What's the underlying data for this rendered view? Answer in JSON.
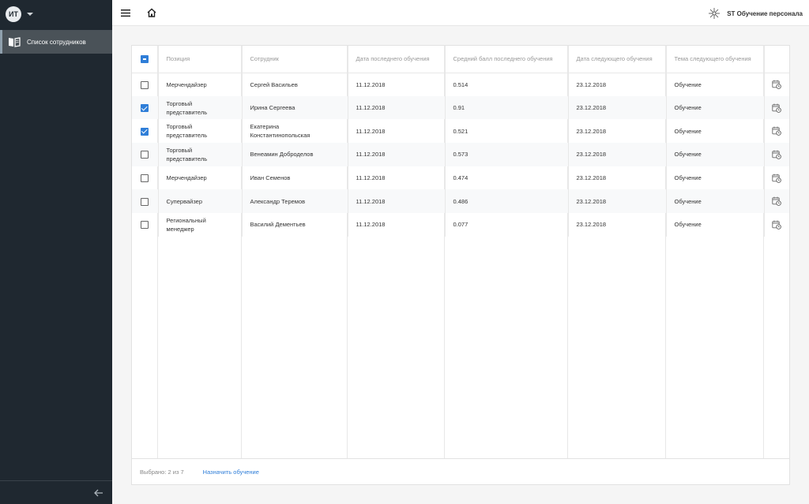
{
  "sidebar": {
    "avatar_initials": "ИТ",
    "items": [
      {
        "label": "Список сотрудников"
      }
    ]
  },
  "header": {
    "brand": "ST Обучение персонала"
  },
  "table": {
    "columns": [
      "Позиция",
      "Сотрудник",
      "Дата последнего обучения",
      "Средний балл последнего обучения",
      "Дата следующего обучения",
      "Тема следующего обучения"
    ],
    "rows": [
      {
        "checked": false,
        "position": "Мерчендайзер",
        "employee": "Сергей Васильев",
        "last_date": "11.12.2018",
        "score": "0.514",
        "next_date": "23.12.2018",
        "topic": "Обучение"
      },
      {
        "checked": true,
        "position": "Торговый представитель",
        "employee": "Ирина Сергеева",
        "last_date": "11.12.2018",
        "score": "0.91",
        "next_date": "23.12.2018",
        "topic": "Обучение"
      },
      {
        "checked": true,
        "position": "Торговый представитель",
        "employee": "Екатерина Константинопольская",
        "last_date": "11.12.2018",
        "score": "0.521",
        "next_date": "23.12.2018",
        "topic": "Обучение"
      },
      {
        "checked": false,
        "position": "Торговый представитель",
        "employee": "Венеамин Доброделов",
        "last_date": "11.12.2018",
        "score": "0.573",
        "next_date": "23.12.2018",
        "topic": "Обучение"
      },
      {
        "checked": false,
        "position": "Мерчендайзер",
        "employee": "Иван Семенов",
        "last_date": "11.12.2018",
        "score": "0.474",
        "next_date": "23.12.2018",
        "topic": "Обучение"
      },
      {
        "checked": false,
        "position": "Супервайзер",
        "employee": "Александр Теремов",
        "last_date": "11.12.2018",
        "score": "0.486",
        "next_date": "23.12.2018",
        "topic": "Обучение"
      },
      {
        "checked": false,
        "position": "Региональный менеджер",
        "employee": "Василий Дементьев",
        "last_date": "11.12.2018",
        "score": "0.077",
        "next_date": "23.12.2018",
        "topic": "Обучение"
      }
    ]
  },
  "footer": {
    "selected": "Выбрано: 2 из 7",
    "assign": "Назначить обучение"
  },
  "colors": {
    "sidebar": "#1f2830",
    "accent": "#2f7ed8",
    "active_item": "#4a5258"
  }
}
